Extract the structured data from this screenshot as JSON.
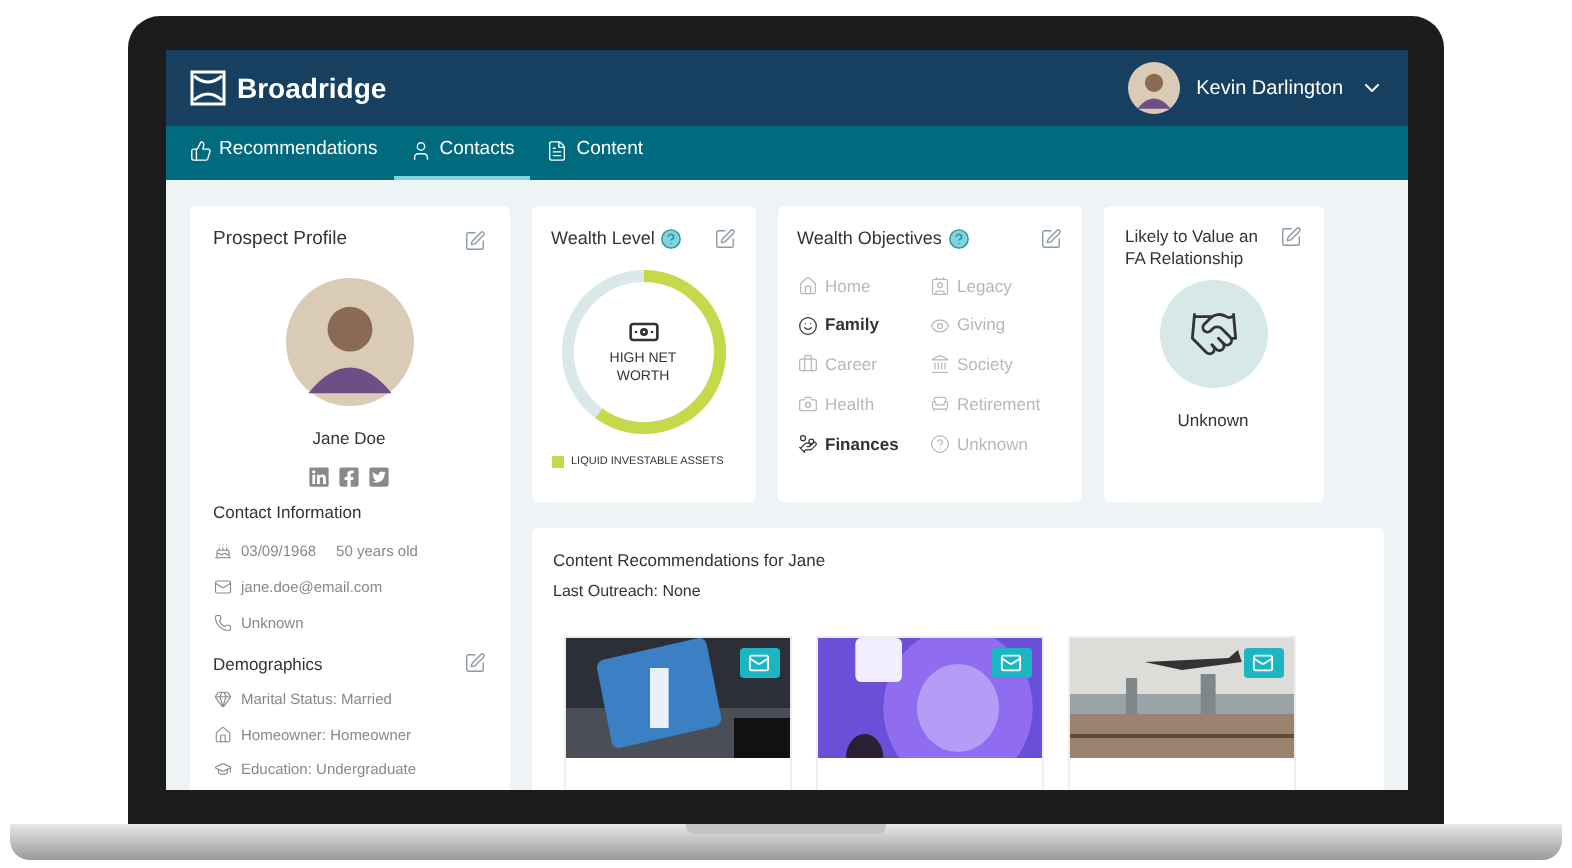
{
  "header": {
    "brand": "Broadridge",
    "user": "Kevin Darlington"
  },
  "tabs": [
    {
      "label": "Recommendations",
      "selected": false
    },
    {
      "label": "Contacts",
      "selected": true
    },
    {
      "label": "Content",
      "selected": false
    }
  ],
  "profile": {
    "title": "Prospect Profile",
    "name": "Jane Doe",
    "contact_heading": "Contact Information",
    "birthdate": "03/09/1968",
    "age": "50 years old",
    "email": "jane.doe@email.com",
    "phone": "Unknown",
    "demographics_heading": "Demographics",
    "demographics": [
      "Marital Status: Married",
      "Homeowner: Homeowner",
      "Education: Undergraduate"
    ]
  },
  "wealth": {
    "title": "Wealth Level",
    "level": 0.6,
    "label": "HIGH NET WORTH",
    "legend": [
      {
        "label": "LIQUID INVESTABLE ASSETS",
        "color": "#c5d94a"
      }
    ]
  },
  "objectives": {
    "title": "Wealth Objectives",
    "items": [
      {
        "label": "Home",
        "selected": false
      },
      {
        "label": "Legacy",
        "selected": false
      },
      {
        "label": "Family",
        "selected": true
      },
      {
        "label": "Giving",
        "selected": false
      },
      {
        "label": "Career",
        "selected": false
      },
      {
        "label": "Society",
        "selected": false
      },
      {
        "label": "Health",
        "selected": false
      },
      {
        "label": "Retirement",
        "selected": false
      },
      {
        "label": "Finances",
        "selected": true
      },
      {
        "label": "Unknown",
        "selected": false
      }
    ]
  },
  "relationship": {
    "title": "Likely to Value an FA Relationship",
    "status": "Unknown"
  },
  "content": {
    "title": "Content Recommendations for Jane",
    "last_outreach": "Last Outreach: None"
  }
}
